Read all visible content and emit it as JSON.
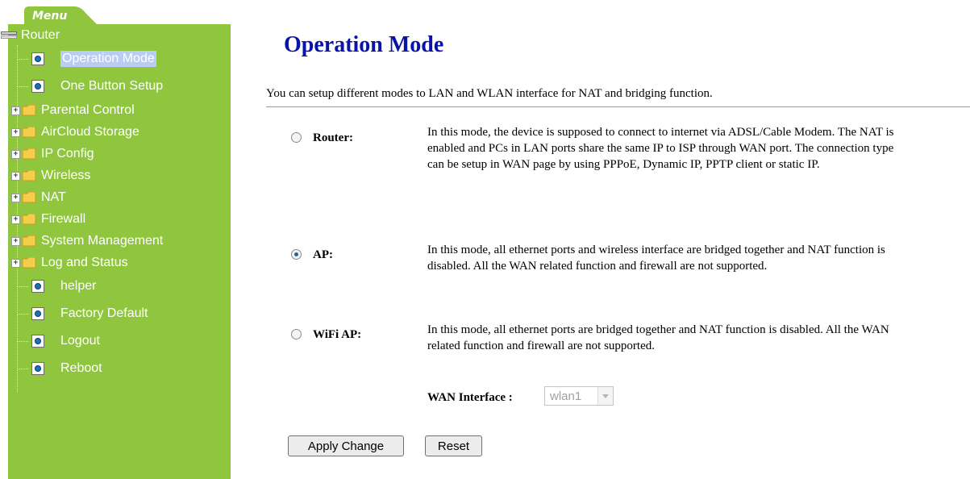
{
  "menu": {
    "tab_label": "Menu",
    "root_label": "Router",
    "items": [
      {
        "label": "Operation Mode",
        "type": "page",
        "selected": true
      },
      {
        "label": "One Button Setup",
        "type": "page"
      },
      {
        "label": "Parental Control",
        "type": "folder"
      },
      {
        "label": "AirCloud Storage",
        "type": "folder"
      },
      {
        "label": "IP Config",
        "type": "folder"
      },
      {
        "label": "Wireless",
        "type": "folder"
      },
      {
        "label": "NAT",
        "type": "folder"
      },
      {
        "label": "Firewall",
        "type": "folder"
      },
      {
        "label": "System Management",
        "type": "folder"
      },
      {
        "label": "Log and Status",
        "type": "folder"
      },
      {
        "label": "helper",
        "type": "page"
      },
      {
        "label": "Factory Default",
        "type": "page"
      },
      {
        "label": "Logout",
        "type": "page"
      },
      {
        "label": "Reboot",
        "type": "page"
      }
    ],
    "expander_symbol": "+",
    "icons": {
      "root": "router-icon",
      "folder": "folder-icon",
      "page": "page-icon"
    },
    "colors": {
      "sidebar_bg": "#8fc63e",
      "selected_bg": "#b9ccf1"
    }
  },
  "main": {
    "title": "Operation Mode",
    "intro": "You can setup different modes to LAN and WLAN interface for NAT and bridging function.",
    "modes": [
      {
        "label": "Router:",
        "checked": false,
        "description": "In this mode, the device is supposed to connect to internet via ADSL/Cable Modem. The NAT is enabled and PCs in LAN ports share the same IP to ISP through WAN port. The connection type can be setup in WAN page by using PPPoE, Dynamic IP, PPTP client or static IP."
      },
      {
        "label": "AP:",
        "checked": true,
        "description": "In this mode, all ethernet ports and wireless interface are bridged together and NAT function is disabled. All the WAN related function and firewall are not supported."
      },
      {
        "label": "WiFi AP:",
        "checked": false,
        "description": "In this mode, all ethernet ports are bridged together and NAT function is disabled. All the WAN related function and firewall are not supported."
      }
    ],
    "wan_interface": {
      "label": "WAN Interface :",
      "value": "wlan1",
      "disabled": true
    },
    "buttons": {
      "apply": "Apply Change",
      "reset": "Reset"
    },
    "colors": {
      "title": "#0a13a8"
    }
  }
}
